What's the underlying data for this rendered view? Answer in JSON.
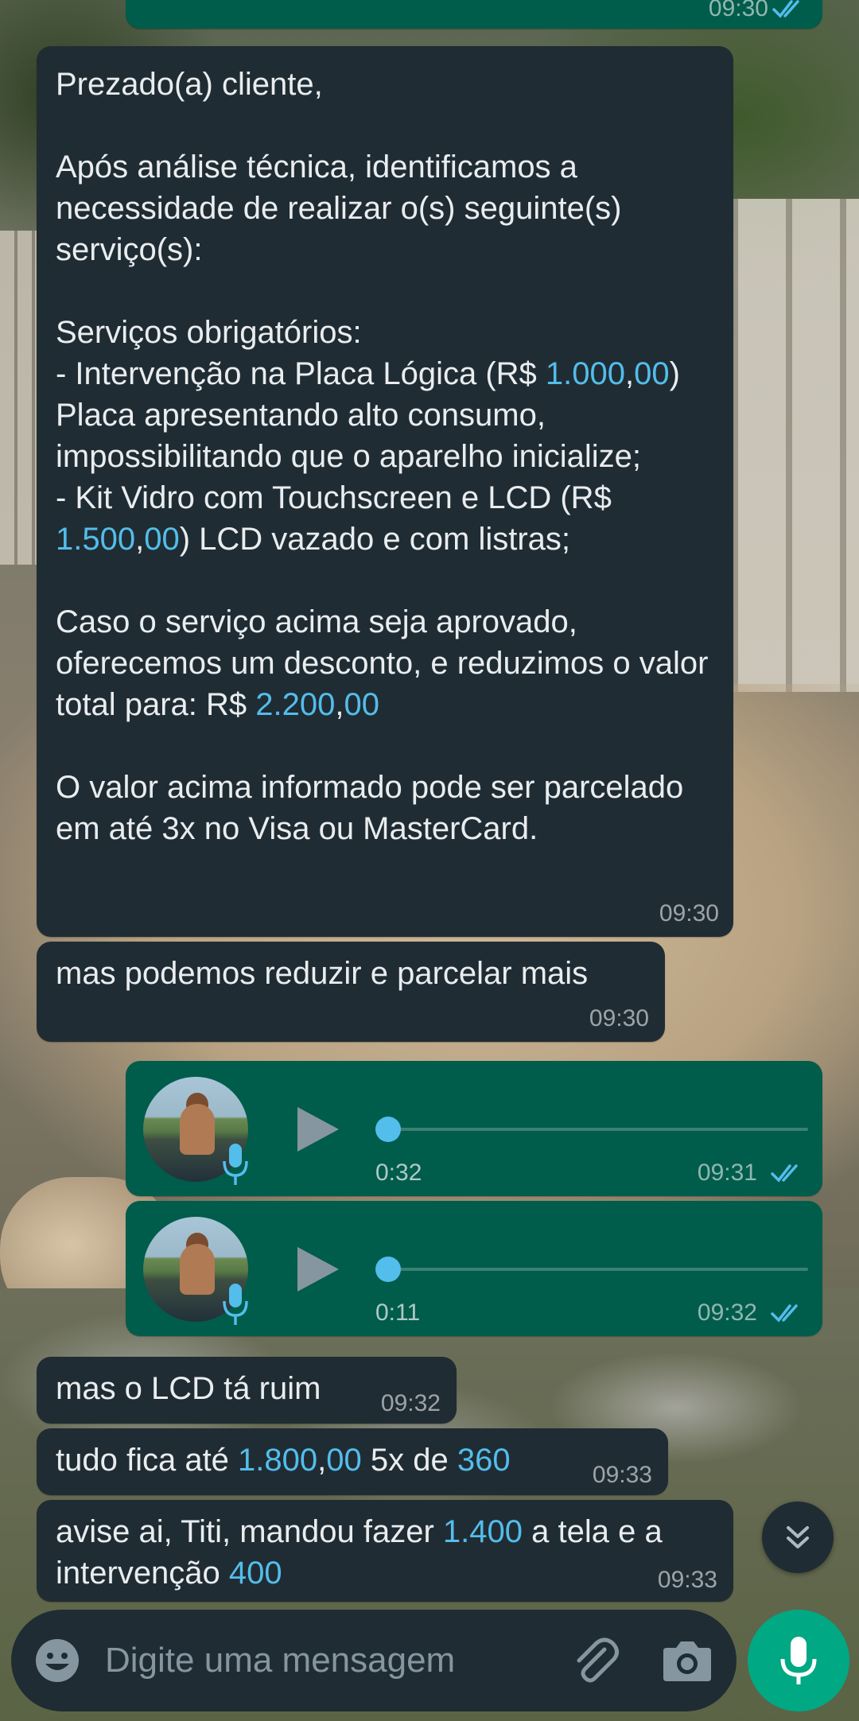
{
  "colors": {
    "incoming_bubble": "#202c33",
    "outgoing_bubble": "#005c4b",
    "link_number": "#53bdeb",
    "accent_green": "#00a884",
    "read_ticks": "#53bdeb"
  },
  "top_message": {
    "time": "09:30",
    "status": "read"
  },
  "message_1": {
    "lines": [
      [
        {
          "t": "Prezado(a) cliente,"
        }
      ],
      [
        {
          "t": ""
        }
      ],
      [
        {
          "t": "Após análise técnica, identificamos a necessidade de realizar o(s) seguinte(s) serviço(s):"
        }
      ],
      [
        {
          "t": ""
        }
      ],
      [
        {
          "t": "Serviços obrigatórios:"
        }
      ],
      [
        {
          "t": "- Intervenção na Placa Lógica (R$ "
        },
        {
          "t": "1.000",
          "n": true
        },
        {
          "t": ","
        },
        {
          "t": "00",
          "n": true
        },
        {
          "t": ") Placa apresentando alto consumo, impossibilitando que o aparelho inicialize;"
        }
      ],
      [
        {
          "t": "- Kit Vidro com Touchscreen e LCD (R$ "
        },
        {
          "t": "1.500",
          "n": true
        },
        {
          "t": ","
        },
        {
          "t": "00",
          "n": true
        },
        {
          "t": ") LCD vazado e com listras;"
        }
      ],
      [
        {
          "t": ""
        }
      ],
      [
        {
          "t": "Caso o serviço acima seja aprovado, oferecemos um desconto, e reduzimos o valor total para: R$ "
        },
        {
          "t": "2.200",
          "n": true
        },
        {
          "t": ","
        },
        {
          "t": "00",
          "n": true
        }
      ],
      [
        {
          "t": ""
        }
      ],
      [
        {
          "t": "O valor acima informado pode ser parcelado em até 3x no Visa ou MasterCard."
        }
      ]
    ],
    "time": "09:30"
  },
  "message_2": {
    "text": "mas podemos reduzir e parcelar mais",
    "time": "09:30"
  },
  "voice_1": {
    "duration": "0:32",
    "time": "09:31",
    "status": "read",
    "progress": 0
  },
  "voice_2": {
    "duration": "0:11",
    "time": "09:32",
    "status": "read",
    "progress": 0
  },
  "message_5": {
    "text": "mas o LCD tá ruim",
    "time": "09:32"
  },
  "message_6": {
    "parts": [
      {
        "t": "tudo fica até "
      },
      {
        "t": "1.800",
        "n": true
      },
      {
        "t": ","
      },
      {
        "t": "00",
        "n": true
      },
      {
        "t": " 5x de "
      },
      {
        "t": "360",
        "n": true
      }
    ],
    "time": "09:33"
  },
  "message_7": {
    "parts": [
      {
        "t": "avise ai, Titi, mandou fazer "
      },
      {
        "t": "1.400",
        "n": true
      },
      {
        "t": " a tela e a intervenção "
      },
      {
        "t": "400",
        "n": true
      }
    ],
    "time": "09:33"
  },
  "icons": {
    "scroll_down": "double-chevron-down-icon",
    "emoji": "emoji-icon",
    "attach": "paperclip-icon",
    "camera": "camera-icon",
    "mic": "microphone-icon",
    "play": "play-icon",
    "read_ticks": "double-check-icon"
  },
  "composer": {
    "placeholder": "Digite uma mensagem"
  }
}
